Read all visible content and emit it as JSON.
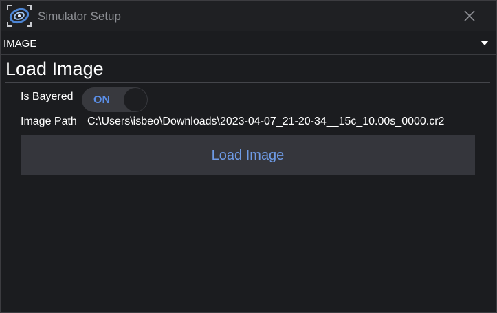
{
  "window": {
    "title": "Simulator Setup",
    "app_icon": "galaxy-app-icon",
    "close_icon": "close-icon"
  },
  "mode_select": {
    "selected": "IMAGE",
    "arrow_icon": "chevron-down-icon"
  },
  "section": {
    "title": "Load Image",
    "is_bayered_label": "Is Bayered",
    "is_bayered_toggle": "ON",
    "image_path_label": "Image Path",
    "image_path_value": "C:\\Users\\isbeo\\Downloads\\2023-04-07_21-20-34__15c_10.00s_0000.cr2",
    "load_button_label": "Load Image"
  },
  "colors": {
    "background": "#1b1c1f",
    "accent": "#5b8fe8",
    "button_bg": "#35363c"
  }
}
